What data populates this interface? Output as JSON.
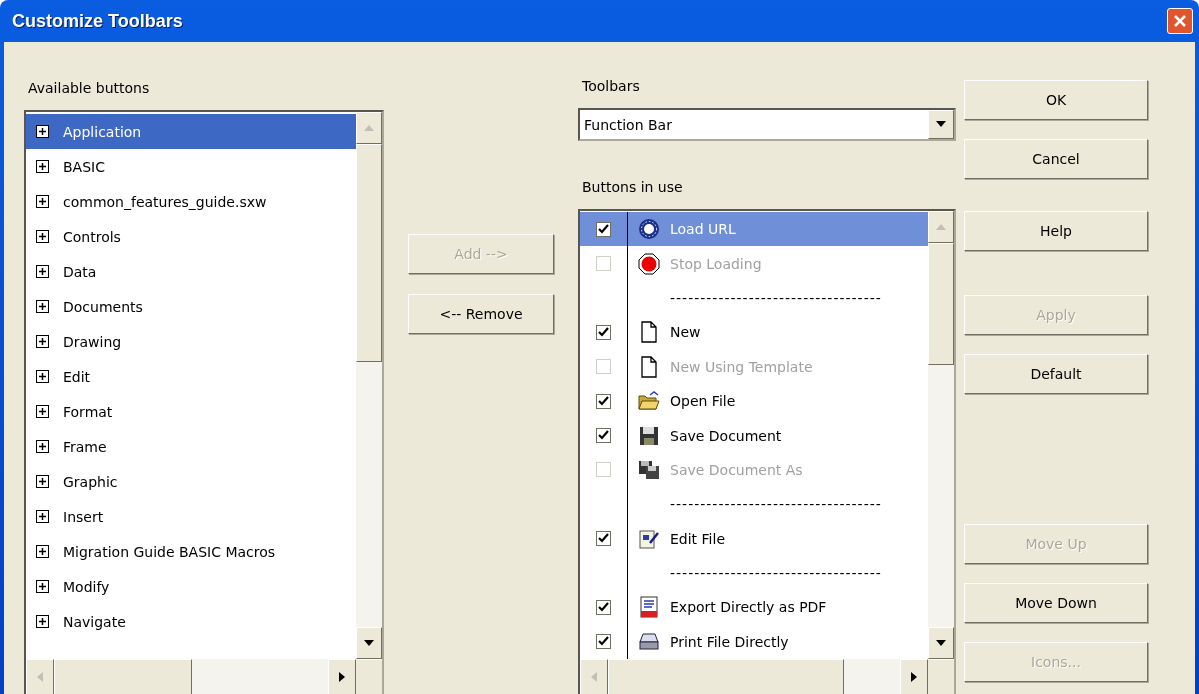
{
  "window": {
    "title": "Customize Toolbars"
  },
  "available": {
    "label": "Available buttons",
    "items": [
      {
        "label": "Application",
        "selected": true
      },
      {
        "label": "BASIC",
        "selected": false
      },
      {
        "label": "common_features_guide.sxw",
        "selected": false
      },
      {
        "label": "Controls",
        "selected": false
      },
      {
        "label": "Data",
        "selected": false
      },
      {
        "label": "Documents",
        "selected": false
      },
      {
        "label": "Drawing",
        "selected": false
      },
      {
        "label": "Edit",
        "selected": false
      },
      {
        "label": "Format",
        "selected": false
      },
      {
        "label": "Frame",
        "selected": false
      },
      {
        "label": "Graphic",
        "selected": false
      },
      {
        "label": "Insert",
        "selected": false
      },
      {
        "label": "Migration Guide BASIC Macros",
        "selected": false
      },
      {
        "label": "Modify",
        "selected": false
      },
      {
        "label": "Navigate",
        "selected": false
      }
    ]
  },
  "middle_buttons": [
    {
      "label": "Add -->",
      "disabled": true
    },
    {
      "label": "<-- Remove",
      "disabled": false
    }
  ],
  "toolbars": {
    "label": "Toolbars",
    "value": "Function Bar"
  },
  "in_use": {
    "label": "Buttons in use",
    "items": [
      {
        "kind": "globe",
        "label": "Load URL",
        "checked": true,
        "selected": true
      },
      {
        "kind": "stop",
        "label": "Stop Loading",
        "checked": false,
        "selected": false
      },
      {
        "kind": "separator",
        "label": "-----------------------------------",
        "selected": false
      },
      {
        "kind": "document",
        "label": "New",
        "checked": true,
        "selected": false
      },
      {
        "kind": "document",
        "label": "New Using Template",
        "checked": false,
        "selected": false
      },
      {
        "kind": "folder",
        "label": "Open File",
        "checked": true,
        "selected": false
      },
      {
        "kind": "floppy",
        "label": "Save Document",
        "checked": true,
        "selected": false
      },
      {
        "kind": "floppies",
        "label": "Save Document As",
        "checked": false,
        "selected": false
      },
      {
        "kind": "separator",
        "label": "-----------------------------------",
        "selected": false
      },
      {
        "kind": "edit",
        "label": "Edit File",
        "checked": true,
        "selected": false
      },
      {
        "kind": "separator",
        "label": "-----------------------------------",
        "selected": false
      },
      {
        "kind": "pdf",
        "label": "Export Directly as PDF",
        "checked": true,
        "selected": false
      },
      {
        "kind": "printer",
        "label": "Print File Directly",
        "checked": true,
        "selected": false
      }
    ]
  },
  "side_buttons": [
    {
      "label": "OK",
      "disabled": false,
      "kind": "top"
    },
    {
      "label": "Cancel",
      "disabled": false,
      "kind": "top"
    },
    {
      "label": "Help",
      "disabled": false,
      "kind": "help"
    },
    {
      "label": "Apply",
      "disabled": true,
      "kind": "mid"
    },
    {
      "label": "Default",
      "disabled": false,
      "kind": "mid"
    },
    {
      "label": "Move Up",
      "disabled": true,
      "kind": "bottom"
    },
    {
      "label": "Move Down",
      "disabled": false,
      "kind": "bottom"
    },
    {
      "label": "Icons...",
      "disabled": true,
      "kind": "bottom"
    }
  ]
}
